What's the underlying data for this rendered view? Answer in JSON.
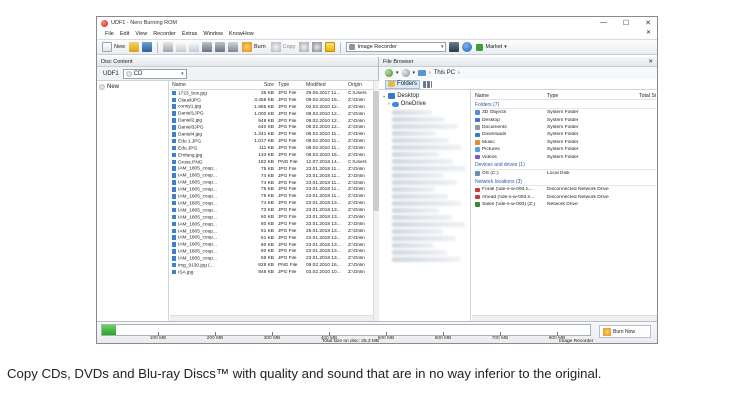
{
  "window": {
    "title": "UDF1 - Nero Burning ROM",
    "min": "—",
    "max": "☐",
    "close": "✕"
  },
  "menu": {
    "items": [
      "File",
      "Edit",
      "View",
      "Recorder",
      "Extras",
      "Window",
      "KnowHow"
    ],
    "close": "✕"
  },
  "toolbar": {
    "new_label": "New",
    "burn_label": "Burn",
    "copy_label": "Copy",
    "recorder": "Image Recorder",
    "market_label": "Market"
  },
  "disc_content": {
    "header": "Disc Content",
    "disc_label": "UDF1",
    "drive": "CD",
    "tree_item": "New",
    "columns": [
      "Name",
      "Size",
      "Type",
      "Modified",
      "Origin"
    ],
    "rows": [
      [
        "1723_box.jpg",
        "35 KB",
        "JPG File",
        "29.05.2017 11...",
        "C:\\Users"
      ],
      [
        "ClaudiJPG",
        "3.458 KB",
        "JPG File",
        "09.02.2010 16...",
        "Z:\\Onlin"
      ],
      [
        "conny1.jpg",
        "1.865 KB",
        "JPG File",
        "02.02.2010 12...",
        "Z:\\Onlin"
      ],
      [
        "Daniel1JPG",
        "1.000 KB",
        "JPG File",
        "08.02.2010 12...",
        "Z:\\Onlin"
      ],
      [
        "Daniel2.jpg",
        "948 KB",
        "JPG File",
        "08.02.2010 12...",
        "Z:\\Onlin"
      ],
      [
        "Daniel3JPG",
        "640 KB",
        "JPG File",
        "08.02.2010 12...",
        "Z:\\Onlin"
      ],
      [
        "Daniel4.jpg",
        "1.341 KB",
        "JPG File",
        "08.02.2010 11...",
        "Z:\\Onlin"
      ],
      [
        "Edu 1.JPG",
        "1.017 KB",
        "JPG File",
        "08.02.2010 11...",
        "Z:\\Onlin"
      ],
      [
        "Edu.JPG",
        "111 KB",
        "JPG File",
        "08.02.2010 11...",
        "Z:\\Onlin"
      ],
      [
        "Emfang.jpg",
        "133 KB",
        "JPG File",
        "08.02.2010 15...",
        "Z:\\Onlin"
      ],
      [
        "Gross.PNG",
        "182 KB",
        "PNG File",
        "12.07.2018 14...",
        "C:\\Users"
      ],
      [
        "IAM_1805_coup...",
        "75 KB",
        "JPG File",
        "23.01.2018 11...",
        "Z:\\Onlin"
      ],
      [
        "IAM_1805_coup...",
        "74 KB",
        "JPG File",
        "23.01.2018 11...",
        "Z:\\Onlin"
      ],
      [
        "IAM_1805_coup...",
        "74 KB",
        "JPG File",
        "23.01.2018 11...",
        "Z:\\Onlin"
      ],
      [
        "IAM_1805_coup...",
        "75 KB",
        "JPG File",
        "23.01.2018 11...",
        "Z:\\Onlin"
      ],
      [
        "IAM_1805_coup...",
        "75 KB",
        "JPG File",
        "23.01.2018 11...",
        "Z:\\Onlin"
      ],
      [
        "IAM_1805_coup...",
        "74 KB",
        "JPG File",
        "23.01.2018 13...",
        "Z:\\Onlin"
      ],
      [
        "IAM_1805_coup...",
        "73 KB",
        "JPG File",
        "23.01.2018 13...",
        "Z:\\Onlin"
      ],
      [
        "IAM_1805_coup...",
        "60 KB",
        "JPG File",
        "23.01.2018 13...",
        "Z:\\Onlin"
      ],
      [
        "IAM_1805_coup...",
        "60 KB",
        "JPG File",
        "23.01.2018 13...",
        "Z:\\Onlin"
      ],
      [
        "IAM_1805_coup...",
        "61 KB",
        "JPG File",
        "25.01.2018 13...",
        "Z:\\Onlin"
      ],
      [
        "IAM_1805_coup...",
        "61 KB",
        "JPG File",
        "23.01.2018 13...",
        "Z:\\Onlin"
      ],
      [
        "IAM_1805_coup...",
        "60 KB",
        "JPG File",
        "23.01.2018 13...",
        "Z:\\Onlin"
      ],
      [
        "IAM_1805_coup...",
        "60 KB",
        "JPG File",
        "23.01.2018 13...",
        "Z:\\Onlin"
      ],
      [
        "IAM_1805_coup...",
        "59 KB",
        "JPG File",
        "23.01.2018 13...",
        "Z:\\Onlin"
      ],
      [
        "img_9130.jpg (...",
        "828 KB",
        "PNG File",
        "09.02.2010 16...",
        "Z:\\Onlin"
      ],
      [
        "ISA.jpg",
        "848 KB",
        "JPG File",
        "03.02.2010 10...",
        "Z:\\Onlin"
      ]
    ]
  },
  "file_browser": {
    "header": "File Browser",
    "breadcrumb": "This PC",
    "folders_label": "Folders",
    "tree_desktop": "Desktop",
    "tree_onedrive": "OneDrive",
    "columns": [
      "Name",
      "Type",
      "Total Si"
    ],
    "groups": [
      {
        "label": "Folders (7)",
        "items": [
          {
            "name": "3D Objects",
            "type": "System Folder",
            "color": "#4a8fd8"
          },
          {
            "name": "Desktop",
            "type": "System Folder",
            "color": "#3a79c8"
          },
          {
            "name": "Documents",
            "type": "System Folder",
            "color": "#8c9aa8"
          },
          {
            "name": "Downloads",
            "type": "System Folder",
            "color": "#3a79c8"
          },
          {
            "name": "Music",
            "type": "System Folder",
            "color": "#e08a3a"
          },
          {
            "name": "Pictures",
            "type": "System Folder",
            "color": "#5aa0d8"
          },
          {
            "name": "Videos",
            "type": "System Folder",
            "color": "#7a5ac8"
          }
        ]
      },
      {
        "label": "Devices and drives (1)",
        "items": [
          {
            "name": "OS (C:)",
            "type": "Local Disk",
            "color": "#6a8cb0"
          }
        ]
      },
      {
        "label": "Network locations (3)",
        "items": [
          {
            "name": "Forall (\\\\de-s-w-093.n...",
            "type": "Disconnected Network Drive",
            "color": "#c83a3a"
          },
          {
            "name": "Ahead (\\\\de-s-w-093.n...",
            "type": "Disconnected Network Drive",
            "color": "#c83a3a"
          },
          {
            "name": "Sales (\\\\de-s-w-093) (Z:)",
            "type": "Network Drive",
            "color": "#3a8a3a"
          }
        ]
      }
    ]
  },
  "capacity": {
    "used_fraction": 0.028,
    "ticks": [
      "100 MB",
      "200 MB",
      "300 MB",
      "400 MB",
      "500 MB",
      "600 MB",
      "700 MB",
      "800 MB"
    ],
    "status_total": "Total size on disc: 25.3 MB",
    "status_recorder": "Image Recorder",
    "burn_now_label": "Burn Now"
  },
  "caption": "Copy CDs, DVDs and Blu-ray Discs™ with quality and sound that are in no way inferior to the original."
}
